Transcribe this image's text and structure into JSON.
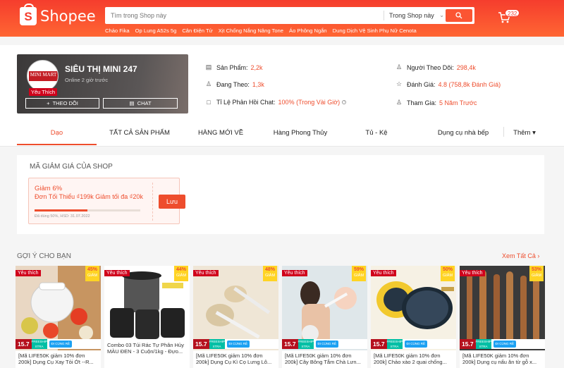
{
  "header": {
    "brand": "Shopee",
    "search_placeholder": "Tìm trong Shop này",
    "search_scope": "Trong Shop này",
    "keywords": [
      "Chảo Fika",
      "Op Lung A52s 5g",
      "Cân Điện Tử",
      "Xịt Chống Nắng Nâng Tone",
      "Áo Phông Ngắn",
      "Dung Dịch Vệ Sinh Phụ Nữ Cenota"
    ],
    "cart_count": "232",
    "accent": "#ee4d2d"
  },
  "shop": {
    "avatar_text": "MINI MART",
    "favorite_label": "Yêu Thích",
    "name": "SIÊU THỊ MINI 247",
    "online": "Online 2 giờ trước",
    "follow_label": "THEO DÕI",
    "chat_label": "CHAT",
    "stats": {
      "products_label": "Sản Phẩm:",
      "products_value": "2,2k",
      "following_label": "Đang Theo:",
      "following_value": "1,3k",
      "reply_label": "Tỉ Lệ Phản Hồi Chat:",
      "reply_value": "100% (Trong Vài Giờ)",
      "followers_label": "Người Theo Dõi:",
      "followers_value": "298,4k",
      "rating_label": "Đánh Giá:",
      "rating_value": "4.8 (758,8k Đánh Giá)",
      "joined_label": "Tham Gia:",
      "joined_value": "5 Năm Trước"
    }
  },
  "tabs": [
    "Dạo",
    "TẤT CẢ SẢN PHẨM",
    "HÀNG MỚI VỀ",
    "Hàng Phong Thủy",
    "Tủ - Kệ",
    "Dụng cụ nhà bếp",
    "Thêm ▾"
  ],
  "voucher": {
    "section_title": "MÃ GIẢM GIÁ CỦA SHOP",
    "discount": "Giảm 6%",
    "desc": "Đơn Tối Thiểu ₫199k Giảm tối đa ₫20k",
    "used_fraction": 0.5,
    "meta": "Đã dùng 50%, HSD: 31.07.2022",
    "save_label": "Lưu"
  },
  "recommend": {
    "title": "GỢI Ý CHO BẠN",
    "see_all": "Xem Tất Cả ›",
    "product_badge": "Yêu thích",
    "discount_word": "GIẢM",
    "promo_price": "15.7",
    "free_ship": "FREESHIP XTRA",
    "cheap_label": "ĐI CÙNG RẺ",
    "products": [
      {
        "discount": "45%",
        "title": "[Mã LIFE50K giảm 10% đơn 200k] Dụng Cụ Xay Tỏi Ớt --R..."
      },
      {
        "discount": "44%",
        "title": "Combo 03 Túi Rác Tự Phân Hủy MÀU ĐEN - 3 Cuộn/1kg - Đựo..."
      },
      {
        "discount": "48%",
        "title": "[Mã LIFE50K giảm 10% đơn 200k] Dụng Cụ Kì Cọ Lưng Lô..."
      },
      {
        "discount": "59%",
        "title": "[Mã LIFE50K giảm 10% đơn 200k] Cây Bông Tắm Chà Lưn..."
      },
      {
        "discount": "50%",
        "title": "[Mã LIFE50K giảm 10% đơn 200k] Chảo xào 2 quai chống..."
      },
      {
        "discount": "53%",
        "title": "[Mã LIFE50K giảm 10% đơn 200k] Dụng cụ nấu ăn từ gỗ x..."
      }
    ]
  }
}
